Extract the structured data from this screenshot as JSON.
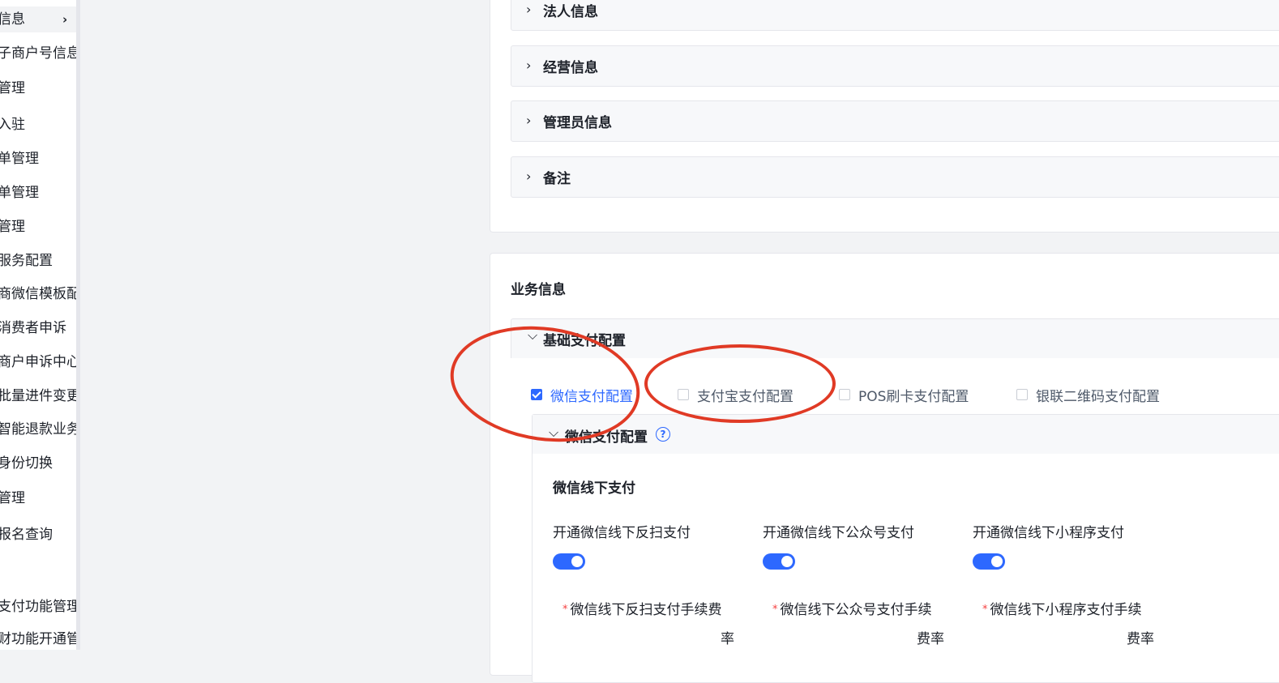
{
  "sidebar": {
    "items": [
      {
        "label": "信息",
        "active": true
      },
      {
        "label": "子商户号信息"
      },
      {
        "label": "管理"
      },
      {
        "label": "入驻"
      },
      {
        "label": "单管理"
      },
      {
        "label": "单管理"
      },
      {
        "label": "管理"
      },
      {
        "label": "服务配置"
      },
      {
        "label": "商微信模板配"
      },
      {
        "label": "消费者申诉"
      },
      {
        "label": "商户申诉中心"
      },
      {
        "label": "批量进件变更"
      },
      {
        "label": "智能退款业务"
      },
      {
        "label": "身份切换"
      },
      {
        "label": "管理"
      },
      {
        "label": "报名查询"
      },
      {
        "label": "支付功能管理"
      },
      {
        "label": "财功能开通管"
      }
    ]
  },
  "top_sections": [
    {
      "label": "法人信息"
    },
    {
      "label": "经营信息"
    },
    {
      "label": "管理员信息"
    },
    {
      "label": "备注"
    }
  ],
  "business": {
    "title": "业务信息",
    "basic_config_label": "基础支付配置",
    "options": [
      {
        "label": "微信支付配置",
        "checked": true
      },
      {
        "label": "支付宝支付配置",
        "checked": false
      },
      {
        "label": "POS刷卡支付配置",
        "checked": false
      },
      {
        "label": "银联二维码支付配置",
        "checked": false
      }
    ],
    "wechat": {
      "header": "微信支付配置",
      "help": "?",
      "offline_title": "微信线下支付",
      "columns": [
        {
          "label": "开通微信线下反扫支付",
          "enabled": true,
          "fee_line1": "微信线下反扫支付手续费",
          "fee_line2": "率"
        },
        {
          "label": "开通微信线下公众号支付",
          "enabled": true,
          "fee_line1": "微信线下公众号支付手续",
          "fee_line2": "费率"
        },
        {
          "label": "开通微信线下小程序支付",
          "enabled": true,
          "fee_line1": "微信线下小程序支付手续",
          "fee_line2": "费率"
        }
      ]
    }
  },
  "colors": {
    "accent": "#2d68ff",
    "annotation": "#e03a25",
    "required": "#f53f3f"
  }
}
